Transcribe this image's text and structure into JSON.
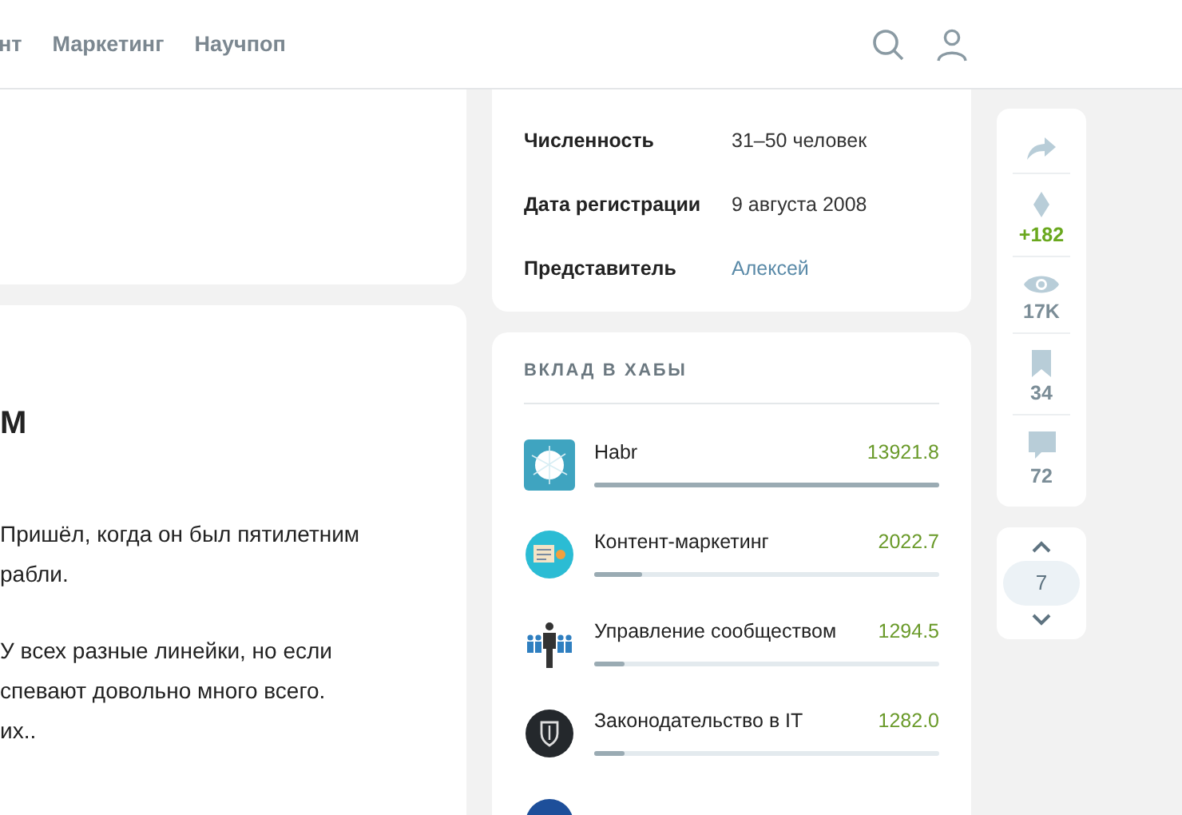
{
  "nav": {
    "links": [
      "нт",
      "Маркетинг",
      "Научпоп"
    ]
  },
  "article": {
    "heading": "М",
    "paragraphs": [
      [
        "Пришёл, когда он был пятилетним",
        "рабли."
      ],
      [
        "У всех разные линейки, но если",
        "спевают довольно много всего.",
        "их.."
      ]
    ]
  },
  "company_info": {
    "rows": [
      {
        "label": "Численность",
        "value": "31–50 человек",
        "kind": "text"
      },
      {
        "label": "Дата регистрации",
        "value": "9 августа 2008",
        "kind": "text"
      },
      {
        "label": "Представитель",
        "value": "Алексей",
        "kind": "link"
      }
    ]
  },
  "hubs": {
    "title": "ВКЛАД В ХАБЫ",
    "items": [
      {
        "name": "Habr",
        "score": "13921.8",
        "level": 1.0,
        "kind": "square"
      },
      {
        "name": "Контент-маркетинг",
        "score": "2022.7",
        "level": 0.14,
        "kind": "content"
      },
      {
        "name": "Управление сообществом",
        "score": "1294.5",
        "level": 0.09,
        "kind": "people"
      },
      {
        "name": "Законодательство в IT",
        "score": "1282.0",
        "level": 0.09,
        "kind": "shield"
      }
    ]
  },
  "stats": {
    "rating": "+182",
    "views": "17K",
    "bookmarks": "34",
    "comments": "72"
  },
  "pager": {
    "value": "7"
  }
}
